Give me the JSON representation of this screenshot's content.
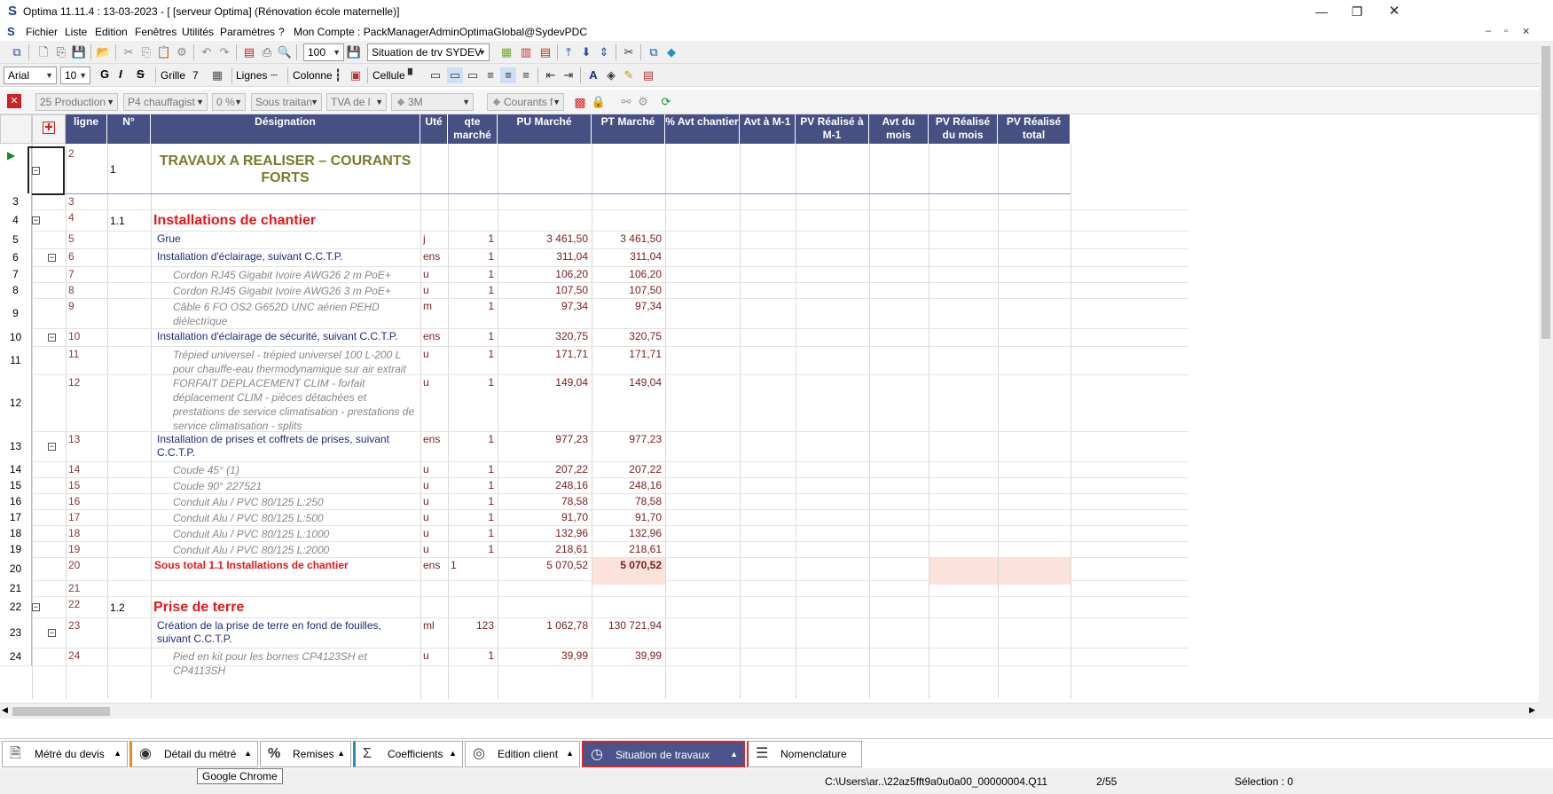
{
  "window": {
    "title": "Optima 11.11.4 : 13-03-2023 - [ [serveur Optima] (Rénovation école maternelle)]",
    "minimize": "—",
    "restore": "❐",
    "close": "✕"
  },
  "menu": {
    "items": [
      "Fichier",
      "Liste",
      "Edition",
      "Fenêtres",
      "Utilités",
      "Paramètres",
      "?"
    ],
    "account": "Mon Compte : PackManagerAdminOptimaGlobal@SydevPDC"
  },
  "toolbar1": {
    "zoom": "100",
    "situation": "Situation de trv  SYDEV"
  },
  "toolbar2": {
    "font": "Arial",
    "size": "10",
    "bold": "G",
    "italic": "I",
    "strike": "S",
    "grille_label": "Grille",
    "grille_value": "7",
    "lignes_label": "Lignes",
    "colonne_label": "Colonne",
    "cellule_label": "Cellule"
  },
  "toolbar3": {
    "production": "25  Production",
    "chauffage": "P4  chauffagist",
    "pct": "0 %",
    "sous_traitant": "Sous traitan",
    "tva": "TVA de l",
    "m3": "3M",
    "courants": "Courants f"
  },
  "columns": [
    "ligne",
    "N°",
    "Désignation",
    "Uté",
    "qte marché",
    "PU Marché",
    "PT Marché",
    "% Avt chantier",
    "Avt à M-1",
    "PV Réalisé à M-1",
    "Avt du mois",
    "PV Réalisé du mois",
    "PV Réalisé total"
  ],
  "rows": [
    {
      "row": "",
      "ligne": "2",
      "num": "1",
      "des": "TRAVAUX A REALISER – COURANTS FORTS",
      "kind": "title",
      "ute": "",
      "qte": "",
      "pu": "",
      "pt": ""
    },
    {
      "row": "3",
      "ligne": "3",
      "num": "",
      "des": "",
      "kind": "blank",
      "ute": "",
      "qte": "",
      "pu": "",
      "pt": ""
    },
    {
      "row": "4",
      "ligne": "4",
      "num": "1.1",
      "des": "Installations de chantier",
      "kind": "h1",
      "ute": "",
      "qte": "",
      "pu": "",
      "pt": ""
    },
    {
      "row": "5",
      "ligne": "5",
      "num": "",
      "des": "Grue",
      "kind": "h2",
      "ute": "j",
      "qte": "1",
      "pu": "3 461,50",
      "pt": "3 461,50"
    },
    {
      "row": "6",
      "ligne": "6",
      "num": "",
      "des": "Installation d'éclairage, suivant C.C.T.P.",
      "kind": "h2",
      "ute": "ens",
      "qte": "1",
      "pu": "311,04",
      "pt": "311,04"
    },
    {
      "row": "7",
      "ligne": "7",
      "num": "",
      "des": "Cordon RJ45 Gigabit Ivoire AWG26 2 m PoE+",
      "kind": "it",
      "ute": "u",
      "qte": "1",
      "pu": "106,20",
      "pt": "106,20"
    },
    {
      "row": "8",
      "ligne": "8",
      "num": "",
      "des": "Cordon RJ45 Gigabit Ivoire AWG26 3 m PoE+",
      "kind": "it",
      "ute": "u",
      "qte": "1",
      "pu": "107,50",
      "pt": "107,50"
    },
    {
      "row": "9",
      "ligne": "9",
      "num": "",
      "des": "Câble 6 FO OS2 G652D UNC aérien PEHD diélectrique",
      "kind": "it",
      "ute": "m",
      "qte": "1",
      "pu": "97,34",
      "pt": "97,34"
    },
    {
      "row": "10",
      "ligne": "10",
      "num": "",
      "des": "Installation d'éclairage de sécurité, suivant C.C.T.P.",
      "kind": "h2",
      "ute": "ens",
      "qte": "1",
      "pu": "320,75",
      "pt": "320,75"
    },
    {
      "row": "11",
      "ligne": "11",
      "num": "",
      "des": "Trépied universel - trépied universel 100 L-200 L pour chauffe-eau thermodynamique sur air extrait",
      "kind": "it",
      "ute": "u",
      "qte": "1",
      "pu": "171,71",
      "pt": "171,71"
    },
    {
      "row": "12",
      "ligne": "12",
      "num": "",
      "des": "FORFAIT DEPLACEMENT CLIM - forfait déplacement CLIM - pièces détachées et prestations de service climatisation - prestations de service climatisation - splits",
      "kind": "it",
      "ute": "u",
      "qte": "1",
      "pu": "149,04",
      "pt": "149,04"
    },
    {
      "row": "13",
      "ligne": "13",
      "num": "",
      "des": "Installation de prises et coffrets de prises, suivant C.C.T.P.",
      "kind": "h2",
      "ute": "ens",
      "qte": "1",
      "pu": "977,23",
      "pt": "977,23"
    },
    {
      "row": "14",
      "ligne": "14",
      "num": "",
      "des": "Coude 45° (1)",
      "kind": "it",
      "ute": "u",
      "qte": "1",
      "pu": "207,22",
      "pt": "207,22"
    },
    {
      "row": "15",
      "ligne": "15",
      "num": "",
      "des": "Coude 90° 227521",
      "kind": "it",
      "ute": "u",
      "qte": "1",
      "pu": "248,16",
      "pt": "248,16"
    },
    {
      "row": "16",
      "ligne": "16",
      "num": "",
      "des": "Conduit Alu / PVC 80/125 L:250",
      "kind": "it",
      "ute": "u",
      "qte": "1",
      "pu": "78,58",
      "pt": "78,58"
    },
    {
      "row": "17",
      "ligne": "17",
      "num": "",
      "des": "Conduit Alu / PVC 80/125 L:500",
      "kind": "it",
      "ute": "u",
      "qte": "1",
      "pu": "91,70",
      "pt": "91,70"
    },
    {
      "row": "18",
      "ligne": "18",
      "num": "",
      "des": "Conduit Alu / PVC 80/125 L:1000",
      "kind": "it",
      "ute": "u",
      "qte": "1",
      "pu": "132,96",
      "pt": "132,96"
    },
    {
      "row": "19",
      "ligne": "19",
      "num": "",
      "des": "Conduit Alu / PVC 80/125 L:2000",
      "kind": "it",
      "ute": "u",
      "qte": "1",
      "pu": "218,61",
      "pt": "218,61"
    },
    {
      "row": "20",
      "ligne": "20",
      "num": "",
      "des": "Sous total 1.1 Installations de chantier",
      "kind": "st",
      "ute": "ens",
      "qte": "1",
      "pu": "5 070,52",
      "pt": "5 070,52"
    },
    {
      "row": "21",
      "ligne": "21",
      "num": "",
      "des": "",
      "kind": "blank",
      "ute": "",
      "qte": "",
      "pu": "",
      "pt": ""
    },
    {
      "row": "22",
      "ligne": "22",
      "num": "1.2",
      "des": "Prise de terre",
      "kind": "h1",
      "ute": "",
      "qte": "",
      "pu": "",
      "pt": ""
    },
    {
      "row": "23",
      "ligne": "23",
      "num": "",
      "des": "Création de la prise de terre en fond de fouilles, suivant C.C.T.P.",
      "kind": "h2",
      "ute": "ml",
      "qte": "123",
      "pu": "1 062,78",
      "pt": "130 721,94"
    },
    {
      "row": "24",
      "ligne": "24",
      "num": "",
      "des": "Pied en kit pour les bornes CP4123SH et CP4113SH",
      "kind": "it",
      "ute": "u",
      "qte": "1",
      "pu": "39,99",
      "pt": "39,99"
    }
  ],
  "tabs": [
    {
      "label": "Métré du devis",
      "icon": "document-icon"
    },
    {
      "label": "Détail du métré",
      "icon": "eye-icon"
    },
    {
      "label": "Remises",
      "icon": "percent-icon"
    },
    {
      "label": "Coefficients",
      "icon": "sigma-icon"
    },
    {
      "label": "Edition client",
      "icon": "user-icon"
    },
    {
      "label": "Situation de travaux",
      "icon": "clock-icon"
    },
    {
      "label": "Nomenclature",
      "icon": "list-icon"
    }
  ],
  "status": {
    "tooltip": "Google Chrome",
    "path": "C:\\Users\\ar..\\22az5fft9a0u0a00_00000004.Q11",
    "page": "2/55",
    "selection": "Sélection : 0"
  },
  "colors": {
    "header_bg": "#465083",
    "active_tab_border": "#d9252a",
    "subtotal_bg": "#fbe3dc",
    "section_red": "#e31818"
  }
}
